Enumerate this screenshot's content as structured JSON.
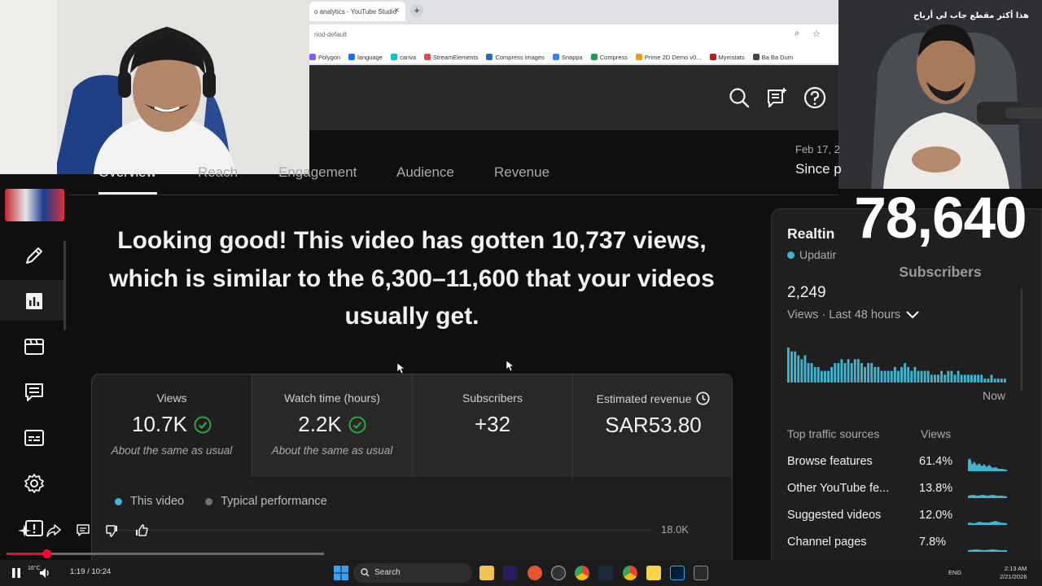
{
  "browser": {
    "tab_title": "o analytics - YouTube Studio",
    "tab_close": "×",
    "new_tab": "+",
    "url": "riod-default",
    "bookmarks": [
      "Polygon",
      "language",
      "canva",
      "StreamElements",
      "Compress images",
      "Snappa",
      "Compress",
      "Prime 2D Demo v0...",
      "Mymstats",
      "Ba Ba Dum"
    ]
  },
  "header": {
    "search_icon": "search-icon",
    "feedback_icon": "feedback-icon",
    "help_icon": "help-icon"
  },
  "tabs": {
    "items": [
      "Overview",
      "Reach",
      "Engagement",
      "Audience",
      "Revenue"
    ],
    "active": "Overview"
  },
  "date_range": {
    "dates": "Feb 17, 2",
    "label": "Since p"
  },
  "headline": "Looking good! This video has gotten 10,737 views, which is similar to the 6,300–11,600 that your videos usually get.",
  "metrics": [
    {
      "label": "Views",
      "value": "10.7K",
      "note": "About the same as usual",
      "status_icon": "check-circle-icon"
    },
    {
      "label": "Watch time (hours)",
      "value": "2.2K",
      "note": "About the same as usual",
      "status_icon": "check-circle-icon"
    },
    {
      "label": "Subscribers",
      "value": "+32",
      "note": ""
    },
    {
      "label": "Estimated revenue",
      "value": "SAR53.80",
      "note": "",
      "label_icon": "clock-icon"
    }
  ],
  "chart_legend": {
    "this_video": "This video",
    "typical": "Typical performance",
    "ytick_top": "18.0K",
    "colors": {
      "this_video": "#41b4d0",
      "typical": "#717171"
    }
  },
  "realtime": {
    "title": "Realtin",
    "status": "Updatir",
    "views": "2,249",
    "period": "Views · Last 48 hours",
    "now_label": "Now",
    "bars": [
      9,
      8,
      8,
      7,
      6,
      7,
      5,
      5,
      4,
      4,
      3,
      3,
      3,
      4,
      5,
      5,
      6,
      5,
      6,
      5,
      6,
      6,
      5,
      4,
      5,
      5,
      4,
      4,
      3,
      3,
      3,
      3,
      4,
      3,
      4,
      5,
      4,
      3,
      4,
      3,
      3,
      3,
      3,
      2,
      2,
      2,
      3,
      2,
      3,
      3,
      2,
      3,
      2,
      2,
      2,
      2,
      2,
      2,
      2,
      1,
      1,
      2,
      1,
      1,
      1,
      1
    ],
    "traffic_header": "Top traffic sources",
    "traffic_col": "Views",
    "sources": [
      {
        "name": "Browse features",
        "pct": "61.4%"
      },
      {
        "name": "Other YouTube fe...",
        "pct": "13.8%"
      },
      {
        "name": "Suggested videos",
        "pct": "12.0%"
      },
      {
        "name": "Channel pages",
        "pct": "7.8%"
      }
    ],
    "accent": "#41b4d0"
  },
  "overlay": {
    "subscribers": "78,640",
    "subscribers_label": "Subscribers",
    "caption": "هذا أكثر مقطع جاب لي أرباح"
  },
  "player": {
    "time": "1:19 / 10:24",
    "progress_fraction": 0.126
  },
  "taskbar": {
    "weather": "16°C",
    "search": "Search",
    "lang": "ENG",
    "clock_time": "2:13 AM",
    "clock_date": "2/21/2026"
  }
}
